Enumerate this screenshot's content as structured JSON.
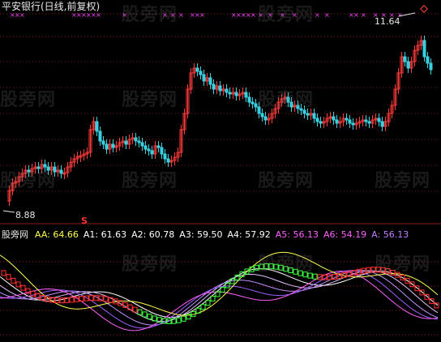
{
  "header": {
    "stock_title": "平安银行(日线,前复权)"
  },
  "price_panel": {
    "high_label": "11.64",
    "low_label": "8.88",
    "signal_mark": "S"
  },
  "indicator_panel": {
    "name": "股旁网",
    "values": [
      {
        "label": "AA: 64.66",
        "color": "#ffff50"
      },
      {
        "label": "A1: 61.63",
        "color": "#ffffff"
      },
      {
        "label": "A2: 60.78",
        "color": "#ffffff"
      },
      {
        "label": "A3: 59.50",
        "color": "#ffffff"
      },
      {
        "label": "A4: 57.92",
        "color": "#ffffff"
      },
      {
        "label": "A5: 56.13",
        "color": "#ff60ff"
      },
      {
        "label": "A6: 54.19",
        "color": "#ff60ff"
      },
      {
        "label": "A: 56.13",
        "color": "#c080ff"
      }
    ]
  },
  "watermark": "股旁网",
  "colors": {
    "up_candle": "#ff3c3c",
    "down_candle": "#38d0e0",
    "grid": "#8a1a1a",
    "marker": "#ff40ff",
    "ind_yellow": "#ffff50",
    "ind_red_box": "#ff3030",
    "ind_green_box": "#40ff40",
    "ribbon": [
      "#ffffff",
      "#e0c0ff",
      "#c090ff",
      "#a060ff",
      "#ff60ff"
    ]
  }
}
